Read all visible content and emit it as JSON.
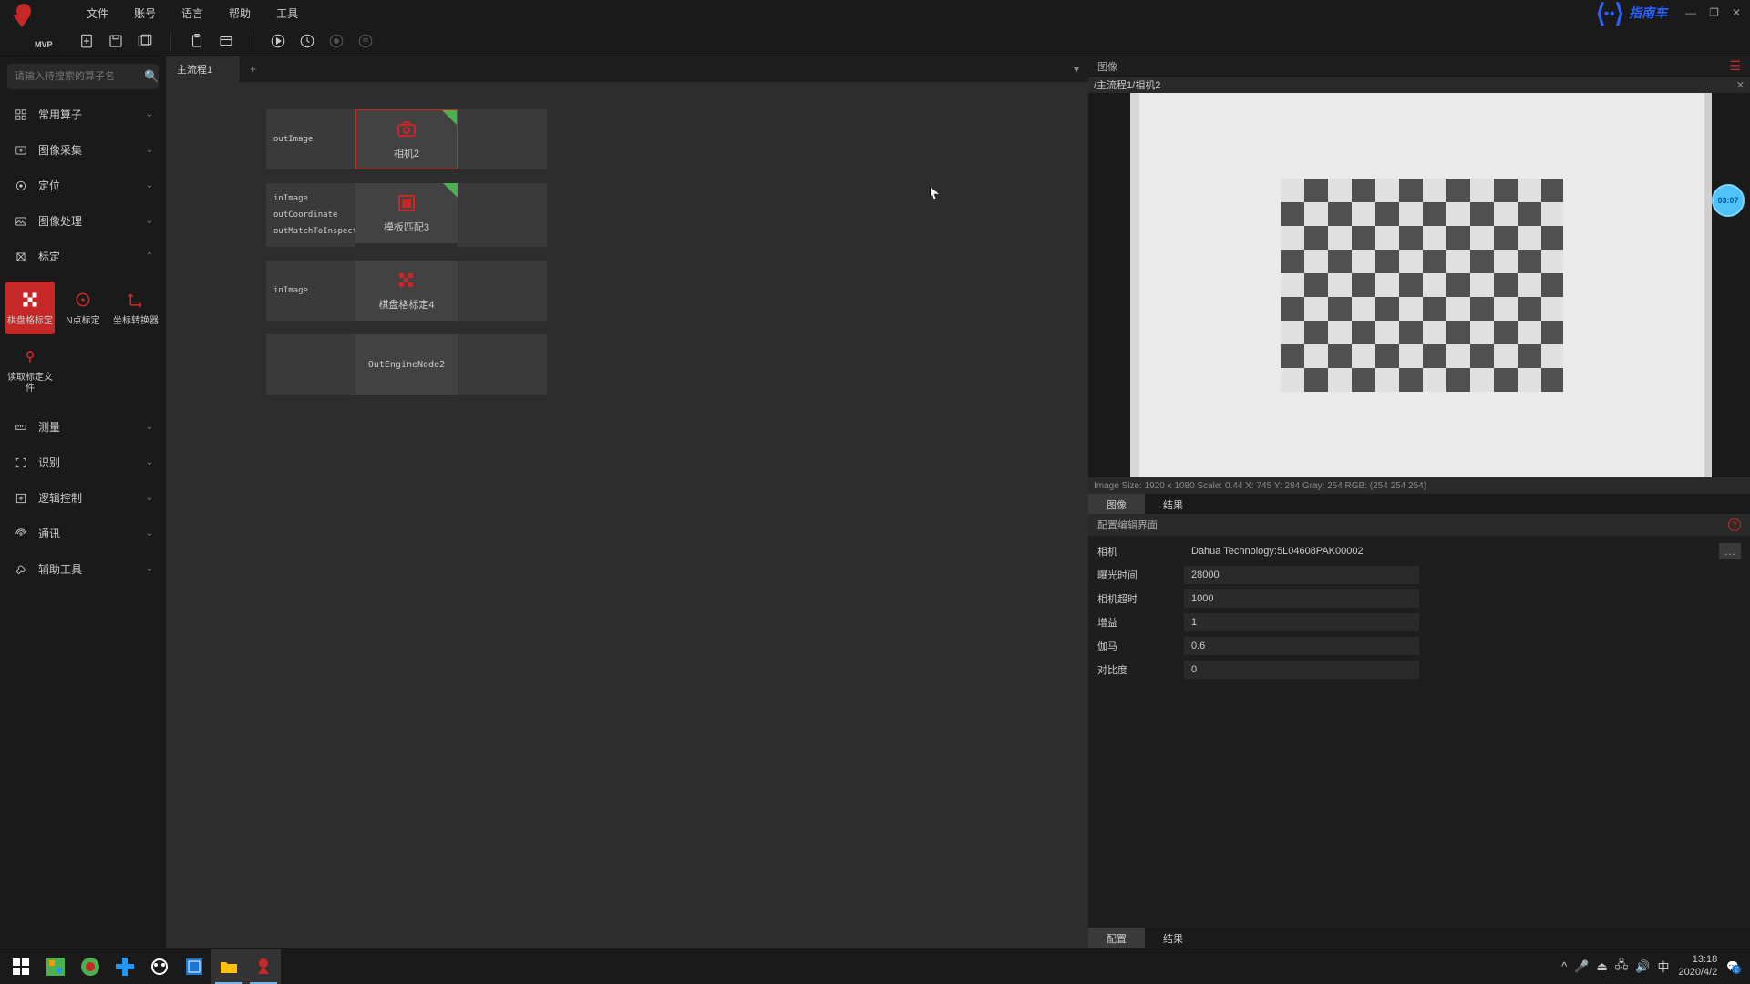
{
  "app": {
    "logo": "MVP"
  },
  "menu": [
    "文件",
    "账号",
    "语言",
    "帮助",
    "工具"
  ],
  "brand": {
    "icon": "⟨··⟩",
    "text": "指南车",
    "sub": ""
  },
  "search": {
    "placeholder": "请输入待搜索的算子名"
  },
  "sidebar": {
    "categories": [
      {
        "label": "常用算子",
        "expanded": false
      },
      {
        "label": "图像采集",
        "expanded": false
      },
      {
        "label": "定位",
        "expanded": false
      },
      {
        "label": "图像处理",
        "expanded": false
      },
      {
        "label": "标定",
        "expanded": true
      },
      {
        "label": "测量",
        "expanded": false
      },
      {
        "label": "识别",
        "expanded": false
      },
      {
        "label": "逻辑控制",
        "expanded": false
      },
      {
        "label": "通讯",
        "expanded": false
      },
      {
        "label": "辅助工具",
        "expanded": false
      }
    ],
    "tools": [
      {
        "label": "棋盘格标定",
        "active": true
      },
      {
        "label": "N点标定",
        "active": false
      },
      {
        "label": "坐标转换器",
        "active": false
      },
      {
        "label": "读取标定文件",
        "active": false
      }
    ]
  },
  "flow": {
    "tab": "主流程1",
    "nodes": [
      {
        "leftPorts": [
          "outImage"
        ],
        "label": "相机2",
        "icon": "camera",
        "check": true,
        "selected": true
      },
      {
        "leftPorts": [
          "inImage",
          "outCoordinate",
          "outMatchToInspect"
        ],
        "label": "模板匹配3",
        "icon": "template",
        "check": true,
        "selected": false
      },
      {
        "leftPorts": [
          "inImage"
        ],
        "label": "棋盘格标定4",
        "icon": "checker",
        "check": false,
        "selected": false
      },
      {
        "leftPorts": [],
        "label": "OutEngineNode2",
        "icon": "",
        "check": false,
        "selected": false
      }
    ]
  },
  "right": {
    "header": "图像",
    "breadcrumb": "/主流程1/相机2",
    "status": "Image Size: 1920 x 1080 Scale: 0.44 X: 745 Y: 284 Gray: 254 RGB: (254 254 254)",
    "viewTabs": [
      "图像",
      "结果"
    ],
    "sectionTitle": "配置编辑界面",
    "props": {
      "camera_label": "相机",
      "camera_value": "Dahua Technology:5L04608PAK00002",
      "exposure_label": "曝光时间",
      "exposure_value": "28000",
      "timeout_label": "相机超时",
      "timeout_value": "1000",
      "gain_label": "增益",
      "gain_value": "1",
      "gamma_label": "伽马",
      "gamma_value": "0.6",
      "contrast_label": "对比度",
      "contrast_value": "0"
    },
    "bottomTabs": [
      "配置",
      "结果"
    ],
    "badge": "03:07"
  },
  "taskbar": {
    "time": "13:18",
    "date": "2020/4/2",
    "ime": "中",
    "notif": "2"
  }
}
